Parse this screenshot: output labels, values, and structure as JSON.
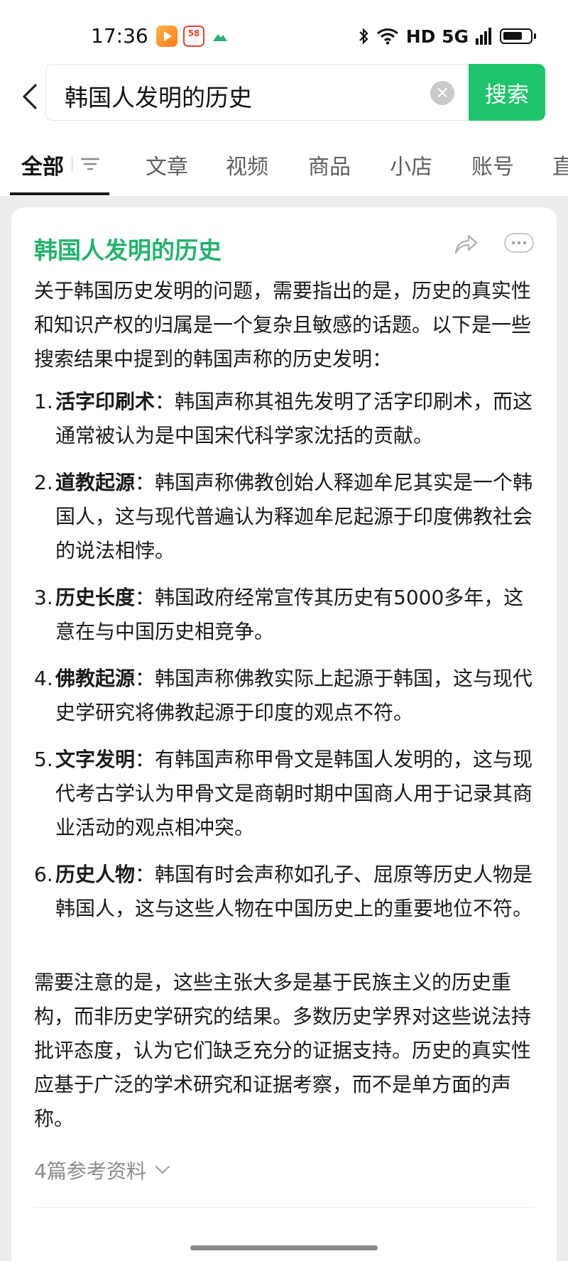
{
  "status_bar": {
    "time": "17:36",
    "app_icons": [
      "video-app-icon",
      "58-app-icon",
      "mountain-app-icon"
    ],
    "job_badge": "58",
    "network": "HD 5G",
    "icons": [
      "bluetooth-icon",
      "wifi-icon",
      "signal-icon",
      "battery-icon"
    ]
  },
  "search": {
    "query": "韩国人发明的历史",
    "button_label": "搜索"
  },
  "tabs": [
    {
      "label": "全部",
      "active": true
    },
    {
      "label": "文章"
    },
    {
      "label": "视频"
    },
    {
      "label": "商品"
    },
    {
      "label": "小店"
    },
    {
      "label": "账号"
    },
    {
      "label": "直"
    }
  ],
  "answer": {
    "title": "韩国人发明的历史",
    "intro": "关于韩国历史发明的问题，需要指出的是，历史的真实性和知识产权的归属是一个复杂且敏感的话题。以下是一些搜索结果中提到的韩国声称的历史发明：",
    "items": [
      {
        "num": "1.",
        "term": "活字印刷术",
        "text": "：韩国声称其祖先发明了活字印刷术，而这通常被认为是中国宋代科学家沈括的贡献。"
      },
      {
        "num": "2.",
        "term": "道教起源",
        "text": "：韩国声称佛教创始人释迦牟尼其实是一个韩国人，这与现代普遍认为释迦牟尼起源于印度佛教社会的说法相悖。"
      },
      {
        "num": "3.",
        "term": "历史长度",
        "text": "：韩国政府经常宣传其历史有5000多年，这意在与中国历史相竞争。"
      },
      {
        "num": "4.",
        "term": "佛教起源",
        "text": "：韩国声称佛教实际上起源于韩国，这与现代史学研究将佛教起源于印度的观点不符。"
      },
      {
        "num": "5.",
        "term": "文字发明",
        "text": "：有韩国声称甲骨文是韩国人发明的，这与现代考古学认为甲骨文是商朝时期中国商人用于记录其商业活动的观点相冲突。"
      },
      {
        "num": "6.",
        "term": "历史人物",
        "text": "：韩国有时会声称如孔子、屈原等历史人物是韩国人，这与这些人物在中国历史上的重要地位不符。"
      }
    ],
    "summary": "需要注意的是，这些主张大多是基于民族主义的历史重构，而非历史学研究的结果。多数历史学界对这些说法持批评态度，认为它们缺乏充分的证据支持。历史的真实性应基于广泛的学术研究和证据考察，而不是单方面的声称。",
    "references": "4篇参考资料"
  },
  "colors": {
    "accent_green": "#1ec46b",
    "title_green": "#21b36c"
  }
}
